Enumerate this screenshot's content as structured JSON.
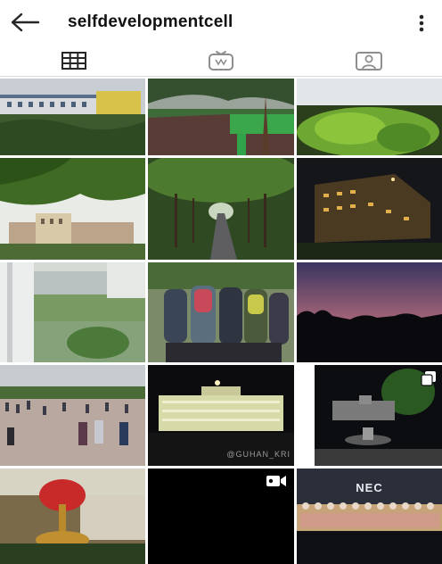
{
  "header": {
    "username": "selfdevelopmentcell",
    "back_icon": "arrow-left-icon",
    "menu_icon": "more-vertical-icon"
  },
  "tabs": [
    {
      "icon": "grid-icon",
      "active": true
    },
    {
      "icon": "igtv-icon",
      "active": false
    },
    {
      "icon": "tagged-user-icon",
      "active": false
    }
  ],
  "posts": {
    "watermark": "@GUHAN_KRI",
    "screen_text": "NEC",
    "video_badge_icon": "video-camera-icon",
    "carousel_badge_icon": "carousel-icon"
  },
  "colors": {
    "text": "#111111",
    "divider": "#dbdbdb",
    "icon": "#262626"
  }
}
